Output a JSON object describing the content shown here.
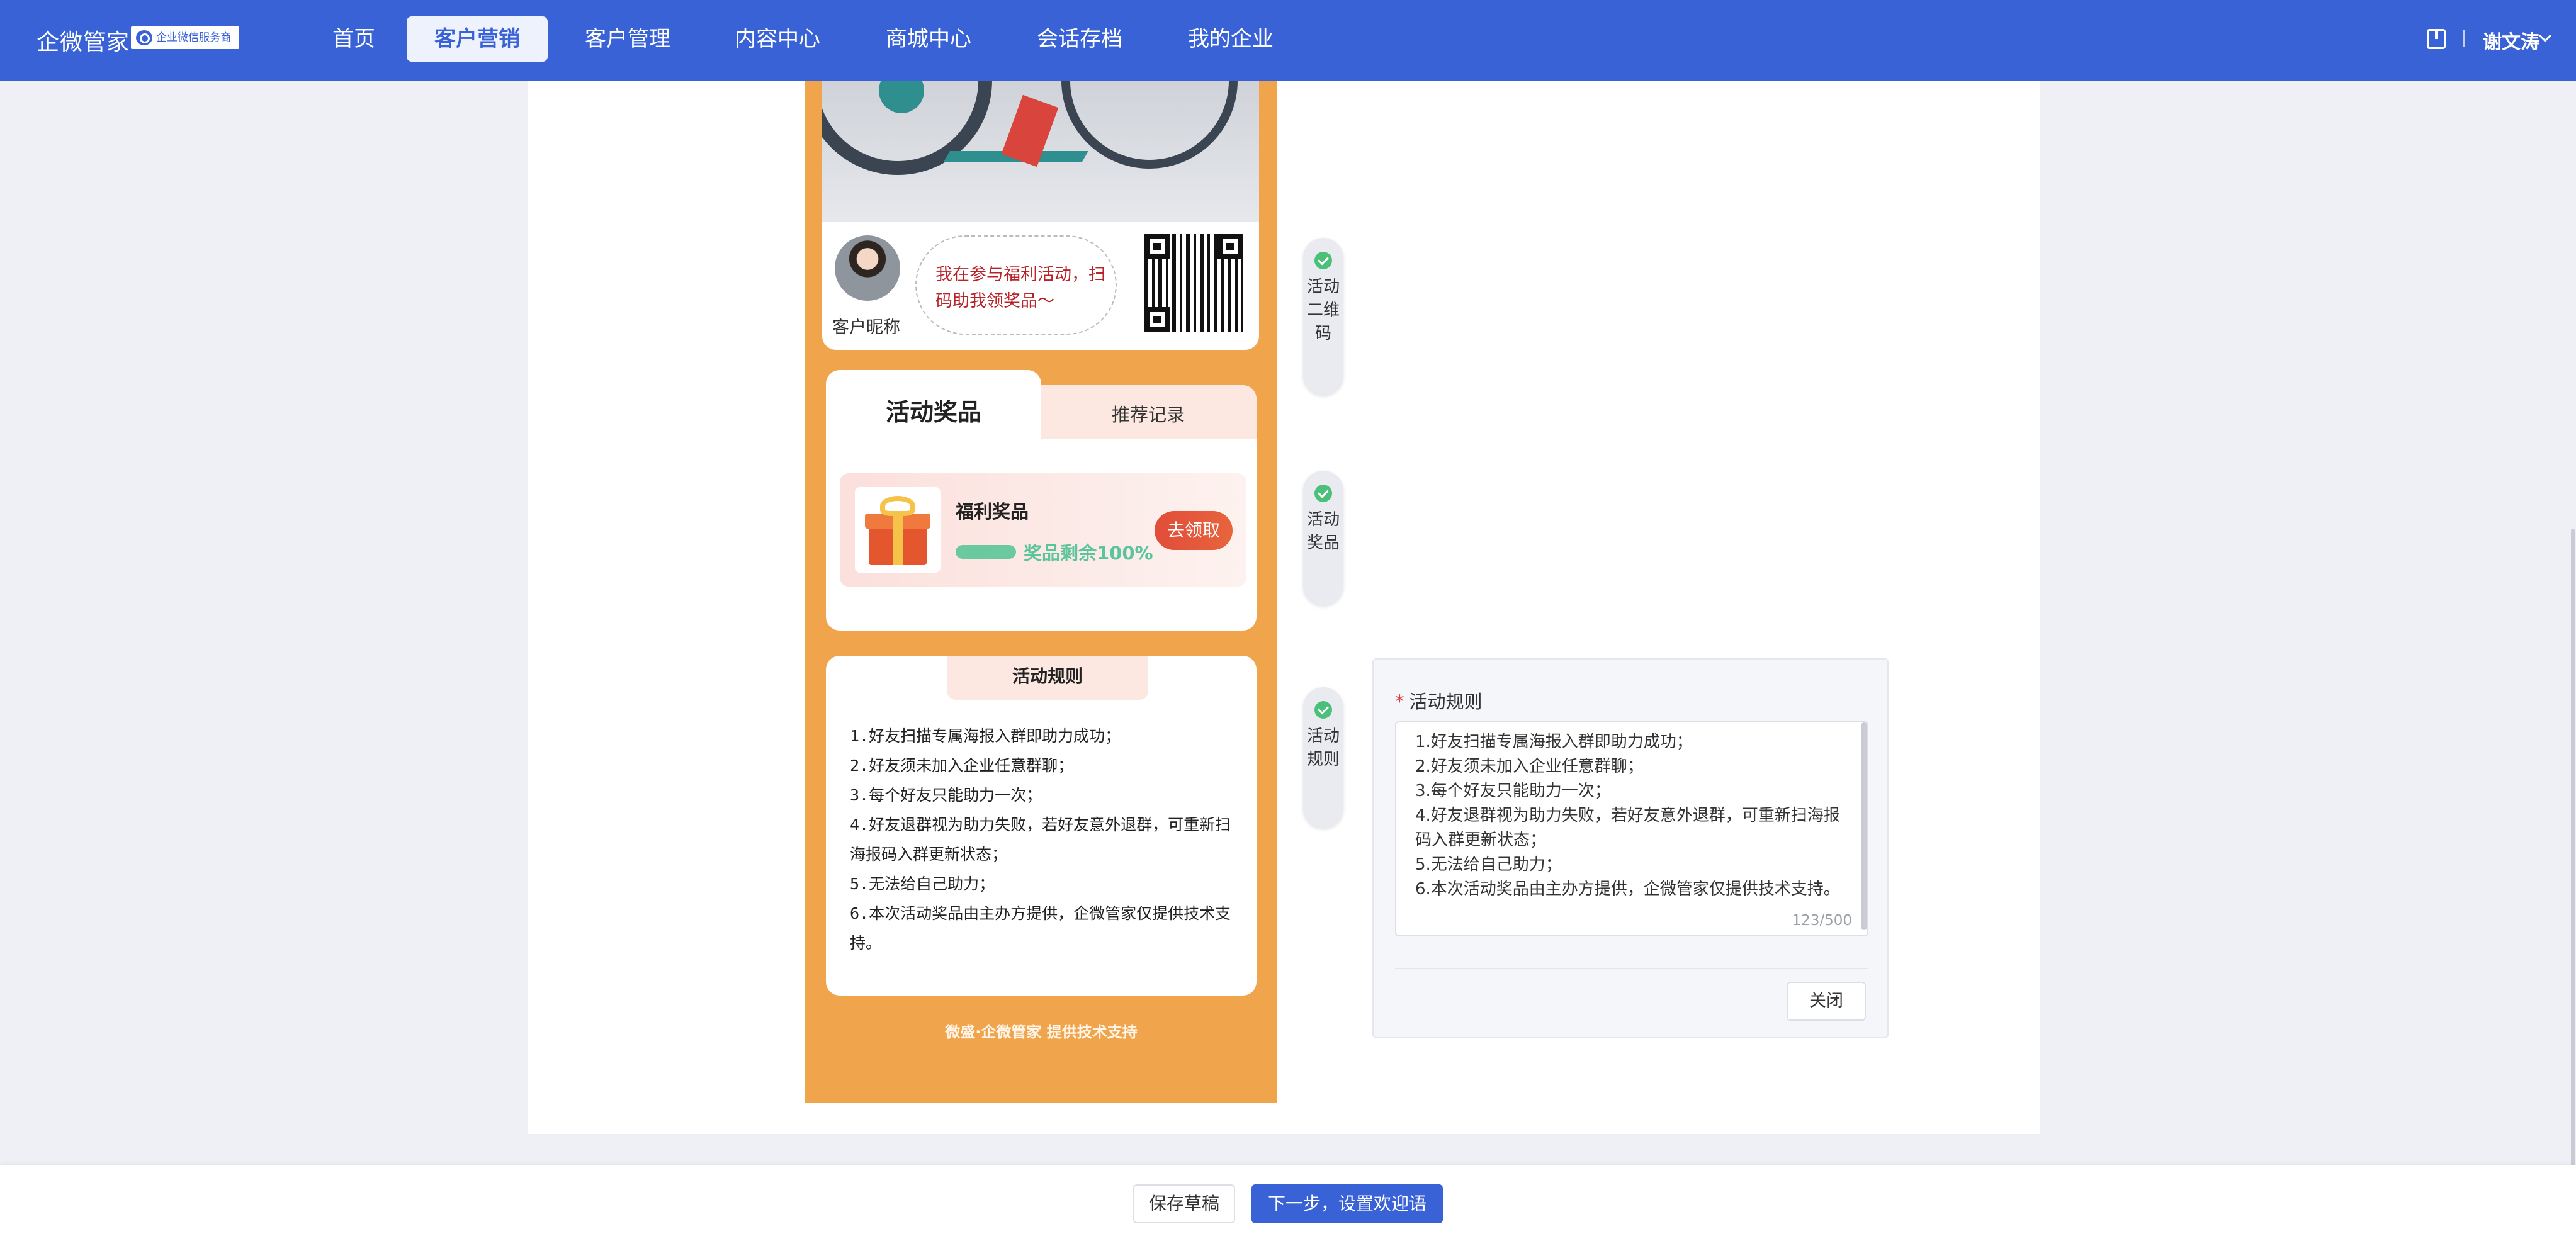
{
  "app": {
    "brand": "企微管家",
    "badge": "企业微信服务商"
  },
  "nav": {
    "items": [
      {
        "label": "首页"
      },
      {
        "label": "客户营销",
        "active": true
      },
      {
        "label": "客户管理"
      },
      {
        "label": "内容中心"
      },
      {
        "label": "商城中心"
      },
      {
        "label": "会话存档"
      },
      {
        "label": "我的企业"
      }
    ],
    "user": "谢文涛"
  },
  "poster": {
    "nickname": "客户昵称",
    "bubble_text": "我在参与福利活动，扫码助我领奖品～"
  },
  "prize": {
    "tab_active": "活动奖品",
    "tab_other": "推荐记录",
    "name": "福利奖品",
    "remain_label": "奖品剩余100%",
    "remaining_fraction": 1.0,
    "claim_label": "去领取"
  },
  "rules": {
    "title": "活动规则",
    "items": [
      "1.好友扫描专属海报入群即助力成功；",
      "2.好友须未加入企业任意群聊；",
      "3.每个好友只能助力一次；",
      "4.好友退群视为助力失败，若好友意外退群，可重新扫海报码入群更新状态；",
      "5.无法给自己助力；",
      "6.本次活动奖品由主办方提供，企微管家仅提供技术支持。"
    ],
    "footer": "微盛·企微管家 提供技术支持"
  },
  "steps": [
    {
      "label": "活动二维码"
    },
    {
      "label": "活动奖品"
    },
    {
      "label": "活动规则"
    }
  ],
  "editor": {
    "label": "活动规则",
    "required_mark": "*",
    "lines": [
      "1.好友扫描专属海报入群即助力成功；",
      "2.好友须未加入企业任意群聊；",
      "3.每个好友只能助力一次；",
      "4.好友退群视为助力失败，若好友意外退群，可重新扫海报码入群更新状态；",
      "5.无法给自己助力；",
      "6.本次活动奖品由主办方提供，企微管家仅提供技术支持。"
    ],
    "counter": "123/500",
    "close_label": "关闭"
  },
  "bottom": {
    "draft_label": "保存草稿",
    "next_label": "下一步，设置欢迎语"
  },
  "colors": {
    "primary": "#3a62d7",
    "poster_bg": "#f0a54c",
    "accent_red": "#e14d3a",
    "success": "#4cc07a"
  }
}
